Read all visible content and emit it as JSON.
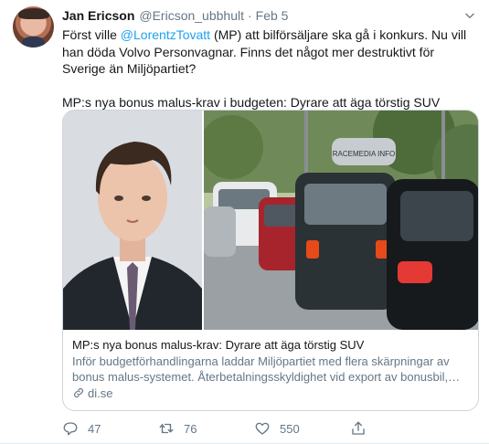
{
  "tweet": {
    "author_name": "Jan Ericson",
    "handle": "@Ericson_ubbhult",
    "separator": "·",
    "date": "Feb 5",
    "text_part1": "Först ville ",
    "mention": "@LorentzTovatt",
    "text_part2": " (MP) att bilförsäljare ska gå i konkurs. Nu vill han döda Volvo Personvagnar. Finns det något mer destruktivt för Sverige än Miljöpartiet?",
    "text_line2": "MP:s nya bonus malus-krav i budgeten: Dyrare att äga törstig SUV"
  },
  "card": {
    "title": "MP:s nya bonus malus-krav: Dyrare att äga törstig SUV",
    "description": "Inför budgetförhandlingarna laddar Miljöpartiet med flera skärpningar av bonus malus-systemet. Återbetalningsskyldighet vid export av bonusbil,…",
    "domain": "di.se",
    "roof_box_label": "RACEMEDIA INFO"
  },
  "actions": {
    "reply_count": "47",
    "retweet_count": "76",
    "like_count": "550"
  },
  "colors": {
    "link": "#1da1f2",
    "secondary_text": "#657786",
    "border": "#ccd6dd"
  },
  "icons": [
    "caret-down-icon",
    "link-icon",
    "reply-icon",
    "retweet-icon",
    "like-icon",
    "share-icon"
  ]
}
